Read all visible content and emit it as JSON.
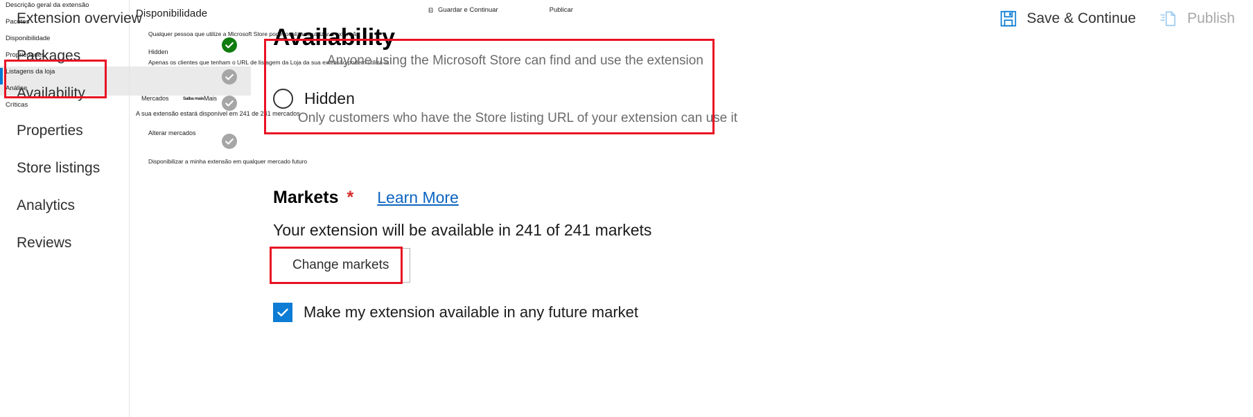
{
  "pt_layer": {
    "nav": {
      "items": [
        {
          "label": "Descrição geral da extensão",
          "selected": false
        },
        {
          "label": "Pacotes",
          "selected": false
        },
        {
          "label": "Disponibilidade",
          "selected": false
        },
        {
          "label": "Propriedades",
          "selected": false
        },
        {
          "label": "Listagens da loja",
          "selected": true
        },
        {
          "label": "Análise",
          "selected": false
        },
        {
          "label": "Críticas",
          "selected": false
        }
      ]
    },
    "page_title": "Disponibilidade",
    "toolbar": {
      "save_icon": "El",
      "save_label": "Guardar e Continuar",
      "publish_label": "Publicar"
    },
    "options": {
      "public_desc": "Qualquer pessoa que utilize a Microsoft Store pode localizar e utilizar a extensão",
      "hidden_label": "Hidden",
      "hidden_desc": "Apenas os clientes que tenham o URL de listagem da Loja da sua extensão podem utilizá-la"
    },
    "markets": {
      "title": "Mercados",
      "learn_more": "Saiba mais",
      "learn_more_overlap": "Mais",
      "info": "A sua extensão estará disponível em 241 de 241 mercados",
      "change_button": "Alterar mercados",
      "future_market": "Disponibilizar a minha extensão em qualquer mercado futuro"
    },
    "check_icons": [
      {
        "name": "check-circle-green",
        "state": "green"
      },
      {
        "name": "check-circle-gray-1",
        "state": "gray"
      },
      {
        "name": "check-circle-gray-2",
        "state": "gray"
      },
      {
        "name": "check-circle-gray-3",
        "state": "gray"
      }
    ]
  },
  "en_layer": {
    "nav": {
      "items": [
        {
          "label": "Extension overview"
        },
        {
          "label": "Packages"
        },
        {
          "label": "Availability"
        },
        {
          "label": "Properties"
        },
        {
          "label": "Store listings"
        },
        {
          "label": "Analytics"
        },
        {
          "label": "Reviews"
        }
      ]
    },
    "page_title": "Availability",
    "toolbar": {
      "save_label": "Save & Continue",
      "publish_label": "Publish"
    },
    "visibility": {
      "public_desc": "Anyone using the Microsoft Store can find and use the extension",
      "hidden_label": "Hidden",
      "hidden_desc": "Only customers who have the Store listing URL of your extension can use it"
    },
    "markets": {
      "title": "Markets",
      "required_mark": "*",
      "learn_more": "Learn More",
      "info": "Your extension will be available in 241 of 241 markets",
      "change_button": "Change markets",
      "future_market_label": "Make my extension available in any future market",
      "future_market_checked": true
    }
  },
  "colors": {
    "annotation": "#e81123",
    "accent_blue": "#0078d4",
    "link_blue": "#0c64c0",
    "checkbox_blue": "#0c7cd5",
    "check_green": "#107c10",
    "check_gray": "#a6a6a6",
    "required_red": "#d62b2b",
    "selected_row": "#eaeaea"
  }
}
